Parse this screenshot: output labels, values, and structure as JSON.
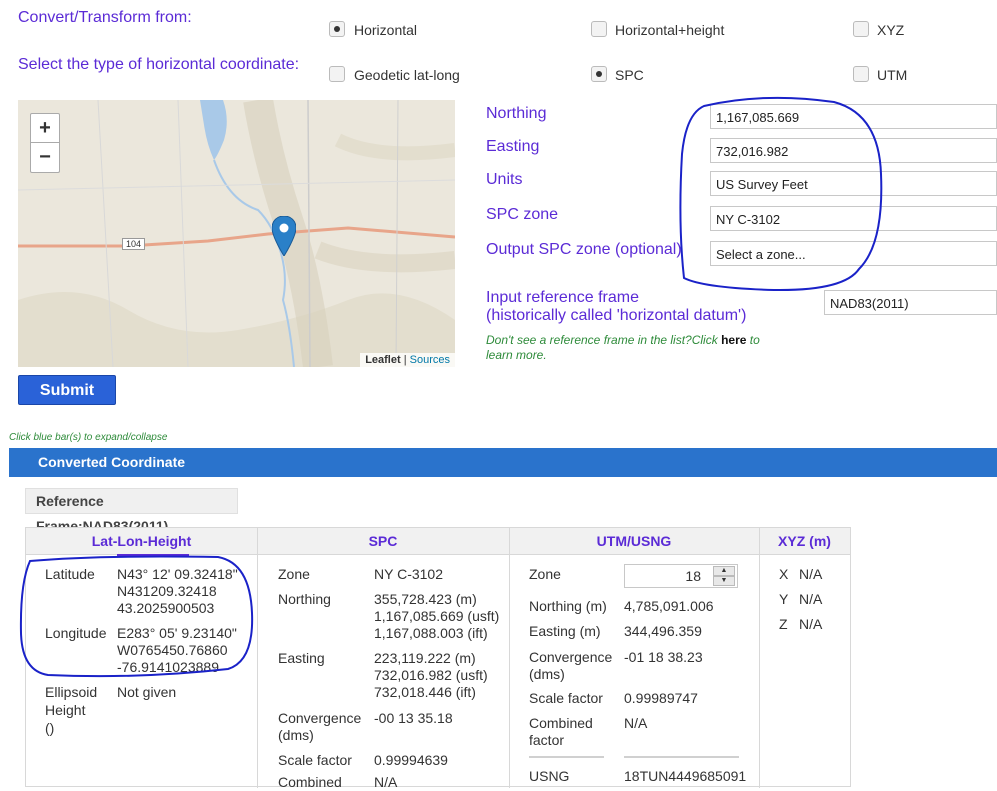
{
  "header": {
    "convert_label": "Convert/Transform from:",
    "type_label": "Select the type of horizontal coordinate:"
  },
  "convert_options": [
    {
      "label": "Horizontal",
      "checked": true
    },
    {
      "label": "Horizontal+height",
      "checked": false
    },
    {
      "label": "XYZ",
      "checked": false
    }
  ],
  "type_options": [
    {
      "label": "Geodetic lat-long",
      "checked": false
    },
    {
      "label": "SPC",
      "checked": true
    },
    {
      "label": "UTM",
      "checked": false
    }
  ],
  "map": {
    "zoom_in": "+",
    "zoom_out": "−",
    "road_label": "104",
    "attrib_leaflet": "Leaflet",
    "attrib_sep": " | ",
    "attrib_sources": "Sources",
    "marker_icon": "map-pin-icon"
  },
  "form": {
    "northing_label": "Northing",
    "northing_value": "1,167,085.669",
    "easting_label": "Easting",
    "easting_value": "732,016.982",
    "units_label": "Units",
    "units_value": "US Survey Feet",
    "spc_zone_label": "SPC zone",
    "spc_zone_value": "NY C-3102",
    "output_zone_label": "Output SPC zone (optional)",
    "output_zone_value": "Select a zone...",
    "ref_frame_label_1": "Input reference frame",
    "ref_frame_label_2": "(historically called 'horizontal datum')",
    "ref_frame_value": "NAD83(2011)",
    "note_prefix": "Don't see a reference frame in the list?Click ",
    "note_link": "here",
    "note_suffix_1": " to",
    "note_suffix_2": "learn more."
  },
  "submit_label": "Submit",
  "expand_note": "Click blue bar(s) to expand/collapse",
  "results": {
    "bar_title": "Converted Coordinate",
    "ref_frame": "Reference Frame:NAD83(2011)",
    "columns": [
      "Lat-Lon-Height",
      "SPC",
      "UTM/USNG",
      "XYZ (m)"
    ],
    "latlon": {
      "lat_label": "Latitude",
      "lat_dms": "N43° 12' 09.32418\"",
      "lat_packed": "N431209.32418",
      "lat_dec": "43.2025900503",
      "lon_label": "Longitude",
      "lon_dms": "E283° 05' 9.23140\"",
      "lon_packed": "W0765450.76860",
      "lon_dec": "-76.9141023889",
      "eh_label_1": "Ellipsoid",
      "eh_label_2": "Height",
      "eh_label_3": "()",
      "eh_value": "Not given"
    },
    "spc": {
      "zone_label": "Zone",
      "zone_value": "NY C-3102",
      "northing_label": "Northing",
      "northing_m": "355,728.423 (m)",
      "northing_usft": "1,167,085.669 (usft)",
      "northing_ift": "1,167,088.003 (ift)",
      "easting_label": "Easting",
      "easting_m": "223,119.222 (m)",
      "easting_usft": "732,016.982 (usft)",
      "easting_ift": "732,018.446 (ift)",
      "conv_label_1": "Convergence",
      "conv_label_2": "(dms)",
      "conv_value": "-00 13 35.18",
      "scale_label": "Scale factor",
      "scale_value": "0.99994639",
      "combined_label": "Combined",
      "combined_value": "N/A"
    },
    "utm": {
      "zone_label": "Zone",
      "zone_value": "18",
      "northing_label": "Northing (m)",
      "northing_value": "4,785,091.006",
      "easting_label": "Easting (m)",
      "easting_value": "344,496.359",
      "conv_label_1": "Convergence",
      "conv_label_2": "(dms)",
      "conv_value": "-01 18 38.23",
      "scale_label": "Scale factor",
      "scale_value": "0.99989747",
      "combined_label_1": "Combined",
      "combined_label_2": "factor",
      "combined_value": "N/A",
      "usng_label": "USNG",
      "usng_value": "18TUN4449685091"
    },
    "xyz": {
      "x_label": "X",
      "x_value": "N/A",
      "y_label": "Y",
      "y_value": "N/A",
      "z_label": "Z",
      "z_value": "N/A"
    }
  }
}
